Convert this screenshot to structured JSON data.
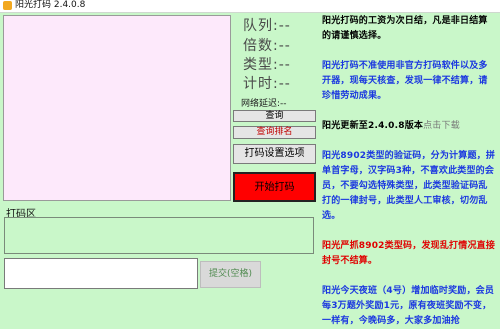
{
  "window": {
    "title": "阳光打码 2.4.0.8"
  },
  "stats": {
    "queue": "队列:--",
    "multiplier": "倍数:--",
    "type": "类型:--",
    "timer": "计时:--",
    "latency": "网络延迟:--"
  },
  "buttons": {
    "query": "查询",
    "rank": "查询排名",
    "settings": "打码设置选项",
    "start": "开始打码",
    "submit": "提交(空格)"
  },
  "typing_area": {
    "label": "打码区"
  },
  "notices": {
    "n1": "阳光打码的工资为次日结，凡是非日结算的请谨慎选择。",
    "n2": "阳光打码不准使用非官方打码软件以及多开器，现每天核查，发现一律不结算，请珍惜劳动成果。",
    "n3_prefix": "阳光更新至2.4.0.8版本",
    "n3_link": "点击下载",
    "n4": "阳光8902类型的验证码，分为计算题，拼单首字母，汉字码3种，不喜欢此类型的会员，不要勾选特殊类型，此类型验证码乱打的一律封号，此类型人工审核，切勿乱选。",
    "n5": "阳光严抓8902类型码，发现乱打情况直接封号不结算。",
    "n6": "阳光今天夜班（4号）增加临时奖励，会员每3万题外奖励1元，原有夜班奖励不变，一样有，今晚码多，大家多加油抢"
  },
  "colors": {
    "background": "#c9f7c9",
    "preview": "#fde9fb",
    "start_button": "#ff0000",
    "notice_blue": "#1a37e0",
    "notice_red": "#e00000"
  }
}
